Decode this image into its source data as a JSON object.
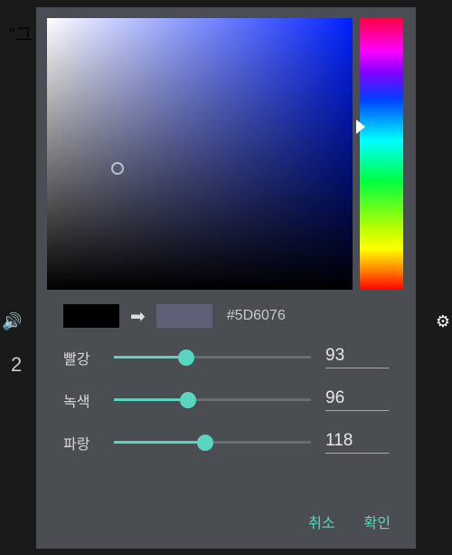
{
  "background": {
    "partial_text": "\"그",
    "number": "2"
  },
  "color_picker": {
    "hex": "#5D6076",
    "old_color": "#000000",
    "new_color": "#5d6076",
    "channels": {
      "red": {
        "label": "빨강",
        "value": "93",
        "max": 255
      },
      "green": {
        "label": "녹색",
        "value": "96",
        "max": 255
      },
      "blue": {
        "label": "파랑",
        "value": "118",
        "max": 255
      }
    },
    "buttons": {
      "cancel": "취소",
      "confirm": "확인"
    }
  }
}
